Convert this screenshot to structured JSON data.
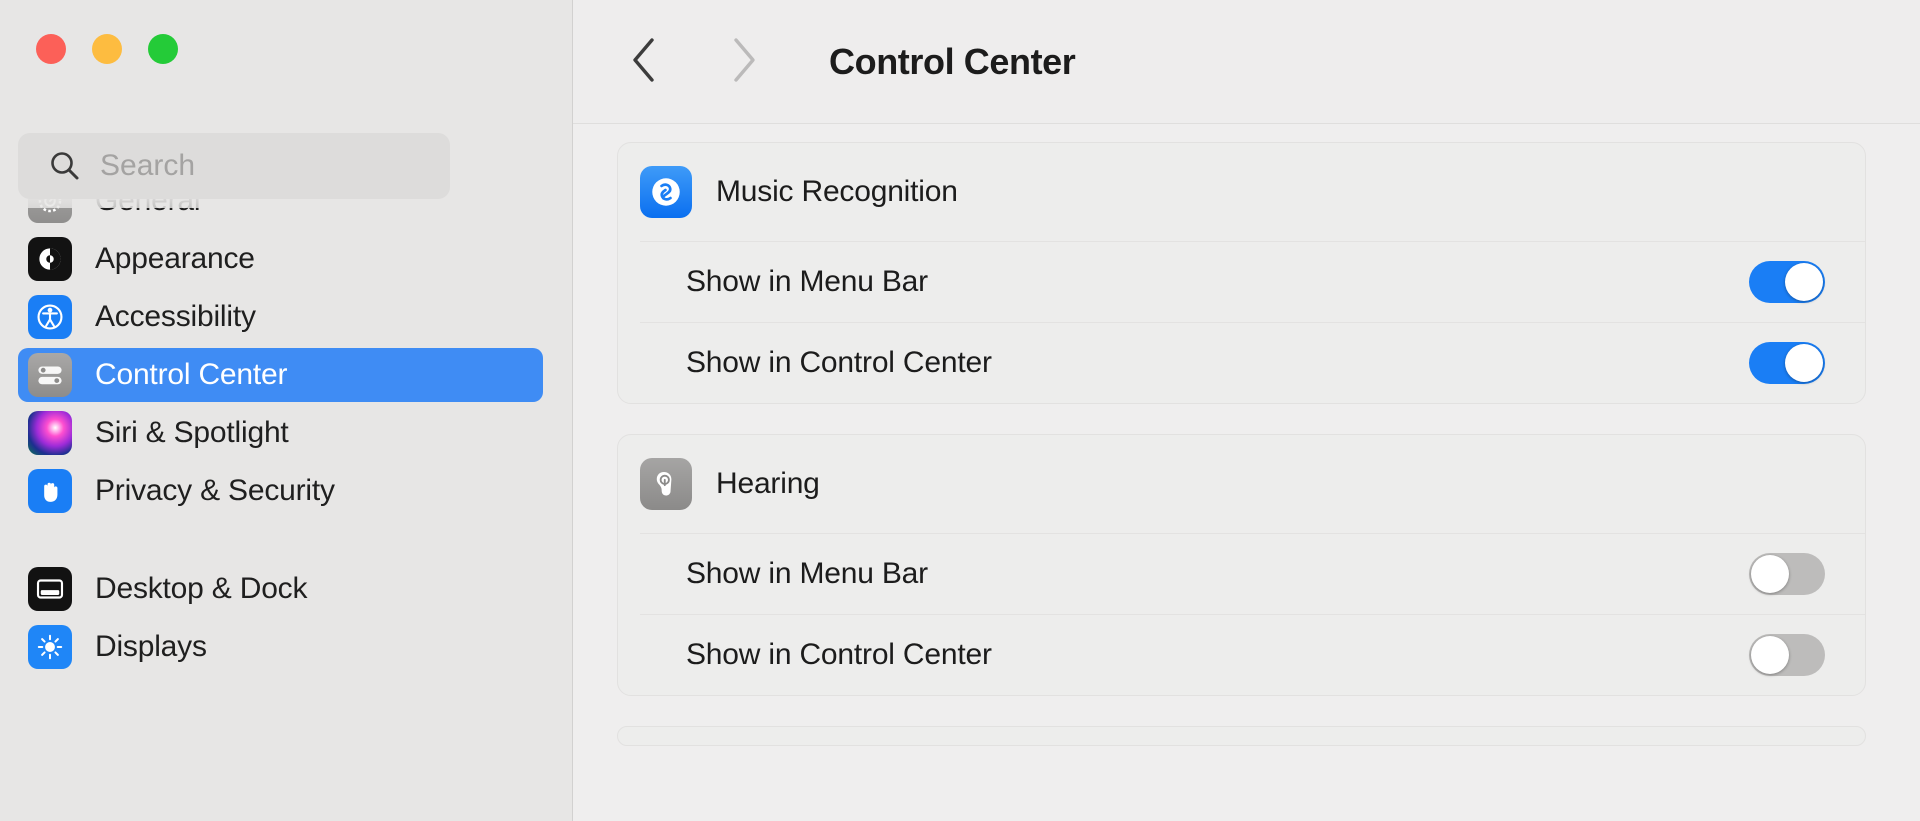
{
  "window": {
    "traffic_lights": [
      {
        "name": "close",
        "color": "#fc6058"
      },
      {
        "name": "minimize",
        "color": "#fdbc40"
      },
      {
        "name": "zoom",
        "color": "#24cb38"
      }
    ]
  },
  "search": {
    "placeholder": "Search",
    "value": "",
    "icon": "search-icon"
  },
  "sidebar": {
    "items": [
      {
        "label": "General",
        "icon": "gear-icon",
        "icon_class": "ic-general",
        "selected": false,
        "clipped": true
      },
      {
        "label": "Appearance",
        "icon": "appearance-icon",
        "icon_class": "ic-appear",
        "selected": false
      },
      {
        "label": "Accessibility",
        "icon": "accessibility-icon",
        "icon_class": "ic-access",
        "selected": false
      },
      {
        "label": "Control Center",
        "icon": "control-center-icon",
        "icon_class": "ic-control",
        "selected": true
      },
      {
        "label": "Siri & Spotlight",
        "icon": "siri-icon",
        "icon_class": "ic-siri",
        "selected": false
      },
      {
        "label": "Privacy & Security",
        "icon": "privacy-hand-icon",
        "icon_class": "ic-privacy",
        "selected": false
      },
      {
        "label": "Desktop & Dock",
        "icon": "desktop-dock-icon",
        "icon_class": "ic-desktop",
        "selected": false
      },
      {
        "label": "Displays",
        "icon": "displays-icon",
        "icon_class": "ic-displays",
        "selected": false
      }
    ],
    "selected_color": "#3f8cf4"
  },
  "toolbar": {
    "back_icon": "chevron-left-icon",
    "forward_icon": "chevron-right-icon",
    "back_enabled": true,
    "forward_enabled": false,
    "title": "Control Center"
  },
  "main": {
    "sections": [
      {
        "name": "music-recognition",
        "title": "Music Recognition",
        "icon": "shazam-icon",
        "icon_class": "ic-shazam",
        "rows": [
          {
            "label": "Show in Menu Bar",
            "toggle": "on"
          },
          {
            "label": "Show in Control Center",
            "toggle": "on"
          }
        ]
      },
      {
        "name": "hearing",
        "title": "Hearing",
        "icon": "ear-icon",
        "icon_class": "ic-hearing",
        "rows": [
          {
            "label": "Show in Menu Bar",
            "toggle": "off"
          },
          {
            "label": "Show in Control Center",
            "toggle": "off"
          }
        ]
      }
    ],
    "toggle_on_color": "#1a7ef5",
    "toggle_off_color": "#bdbcbb"
  }
}
